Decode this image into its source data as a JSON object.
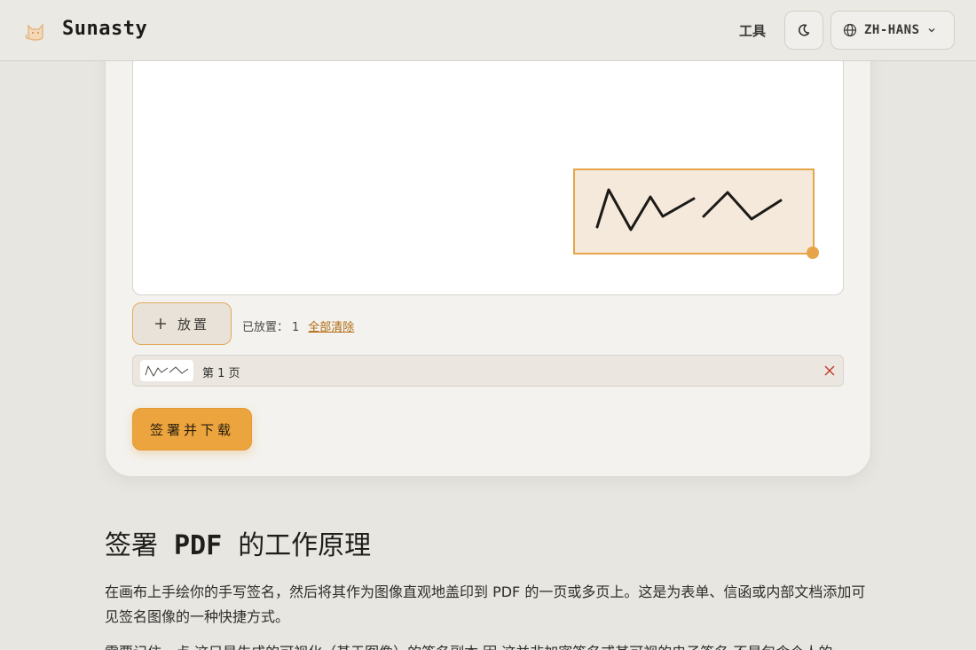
{
  "header": {
    "brand": "Sunasty",
    "nav_tools": "工具",
    "theme_icon": "moon-icon",
    "language": "ZH-HANS",
    "language_icon": "globe-icon",
    "language_chevron": "chevron-down-icon"
  },
  "editor": {
    "place_button": "放置",
    "place_icon": "plus-icon",
    "placed_label": "已放置：",
    "placed_count": "1",
    "clear_all": "全部清除",
    "pages": [
      {
        "label": "第 1 页",
        "remove_icon": "close-icon"
      }
    ],
    "sign_download_button": "签署并下载",
    "accent_color": "#e7a54a"
  },
  "article": {
    "heading_pre": "签署",
    "heading_pdf": "PDF",
    "heading_post": "的工作原理",
    "paragraph1": "在画布上手绘你的手写签名，然后将其作为图像直观地盖印到 PDF 的一页或多页上。这是为表单、信函或内部文档添加可见签名图像的一种快捷方式。",
    "paragraph2": "需要记住一点 这只是生成的可视化（基于图像）的签名副本 因 这并非加密签名或其可视的电子签名 不是包含个人的"
  }
}
